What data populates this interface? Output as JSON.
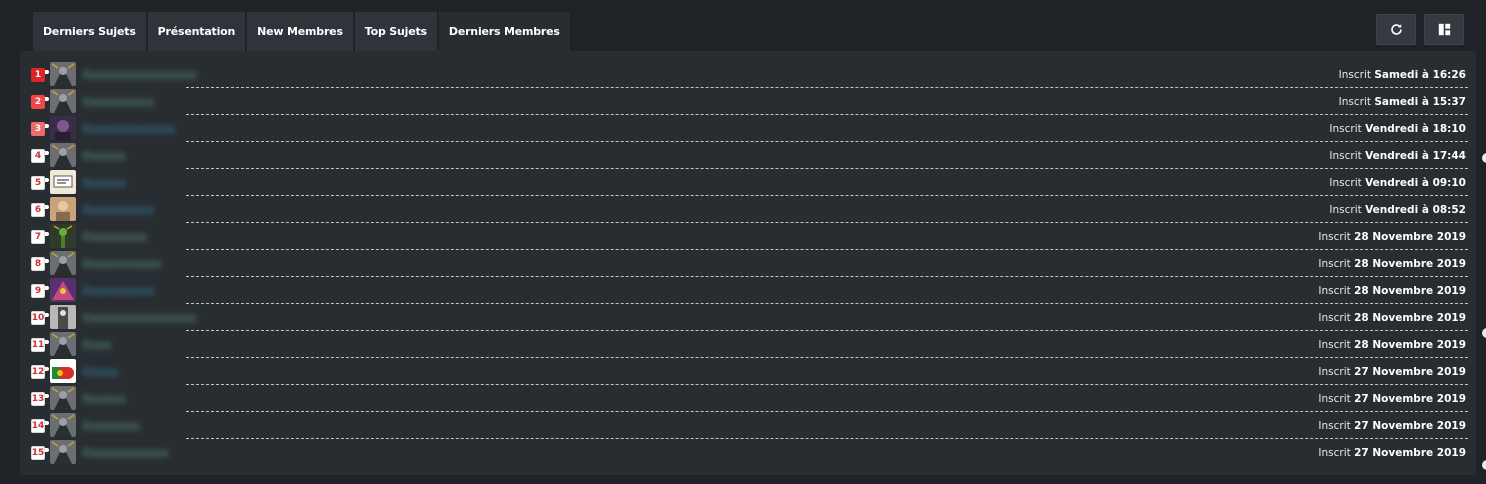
{
  "tabs": [
    {
      "label": "Derniers Sujets",
      "active": false
    },
    {
      "label": "Présentation",
      "active": false
    },
    {
      "label": "New Membres",
      "active": false
    },
    {
      "label": "Top Sujets",
      "active": false
    },
    {
      "label": "Derniers Membres",
      "active": true
    }
  ],
  "toolbar": {
    "refresh_icon": "refresh-icon",
    "layout_icon": "layout-icon"
  },
  "colors": {
    "rank1": "#e02424",
    "rank2": "#f04646",
    "rank3": "#ee6b6b",
    "member_green": "#6fb38f",
    "member_blue": "#3e9dc8"
  },
  "members": [
    {
      "rank": "1",
      "name": "Xxxxxxxxxxxxxxxx",
      "name_color": "green",
      "avatar": "gray",
      "prefix": "Inscrit",
      "date": "Samedi à 16:26"
    },
    {
      "rank": "2",
      "name": "Xxxxxxxxxx",
      "name_color": "green",
      "avatar": "gray",
      "prefix": "Inscrit",
      "date": "Samedi à 15:37"
    },
    {
      "rank": "3",
      "name": "Xxxxxxxxxxxxx",
      "name_color": "blue",
      "avatar": "dark",
      "prefix": "Inscrit",
      "date": "Vendredi à 18:10"
    },
    {
      "rank": "4",
      "name": "Xxxxxx",
      "name_color": "green",
      "avatar": "gray",
      "prefix": "Inscrit",
      "date": "Vendredi à 17:44"
    },
    {
      "rank": "5",
      "name": "Xxxxxx",
      "name_color": "blue",
      "avatar": "sign",
      "prefix": "Inscrit",
      "date": "Vendredi à 09:10"
    },
    {
      "rank": "6",
      "name": "Xxxxxxxxxx",
      "name_color": "blue",
      "avatar": "tan",
      "prefix": "Inscrit",
      "date": "Vendredi à 08:52"
    },
    {
      "rank": "7",
      "name": "Xxxxxxxxx",
      "name_color": "green",
      "avatar": "green",
      "prefix": "Inscrit",
      "date": "28 Novembre 2019"
    },
    {
      "rank": "8",
      "name": "Xxxxxxxxxxx",
      "name_color": "green",
      "avatar": "gray",
      "prefix": "Inscrit",
      "date": "28 Novembre 2019"
    },
    {
      "rank": "9",
      "name": "Xxxxxxxxxx",
      "name_color": "blue",
      "avatar": "purple",
      "prefix": "Inscrit",
      "date": "28 Novembre 2019"
    },
    {
      "rank": "10",
      "name": "Xxxxxxxxxxxxxxxx",
      "name_color": "green",
      "avatar": "silver",
      "prefix": "Inscrit",
      "date": "28 Novembre 2019"
    },
    {
      "rank": "11",
      "name": "Xxxx",
      "name_color": "green",
      "avatar": "gray",
      "prefix": "Inscrit",
      "date": "28 Novembre 2019"
    },
    {
      "rank": "12",
      "name": "Xxxxx",
      "name_color": "blue",
      "avatar": "flag",
      "prefix": "Inscrit",
      "date": "27 Novembre 2019"
    },
    {
      "rank": "13",
      "name": "Xxxxxx",
      "name_color": "green",
      "avatar": "gray",
      "prefix": "Inscrit",
      "date": "27 Novembre 2019"
    },
    {
      "rank": "14",
      "name": "Xxxxxxxx",
      "name_color": "green",
      "avatar": "gray",
      "prefix": "Inscrit",
      "date": "27 Novembre 2019"
    },
    {
      "rank": "15",
      "name": "Xxxxxxxxxxxx",
      "name_color": "green",
      "avatar": "gray",
      "prefix": "Inscrit",
      "date": "27 Novembre 2019"
    }
  ]
}
